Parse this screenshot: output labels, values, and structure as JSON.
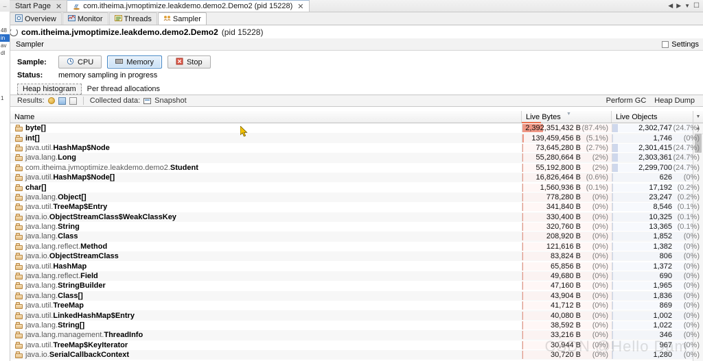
{
  "window": {
    "tabs": [
      {
        "label": "Start Page",
        "icon": "none",
        "active": false,
        "closable": true
      },
      {
        "label": "com.itheima.jvmoptimize.leakdemo.demo2.Demo2 (pid 15228)",
        "icon": "java-app-icon",
        "active": true,
        "closable": true
      }
    ],
    "controls": [
      "prev-arrow",
      "next-arrow",
      "dropdown-arrow",
      "maximize"
    ]
  },
  "tool_tabs": [
    {
      "label": "Overview",
      "icon": "overview-icon",
      "active": false
    },
    {
      "label": "Monitor",
      "icon": "monitor-icon",
      "active": false
    },
    {
      "label": "Threads",
      "icon": "threads-icon",
      "active": false
    },
    {
      "label": "Sampler",
      "icon": "sampler-icon",
      "active": true
    }
  ],
  "process": {
    "name": "com.itheima.jvmoptimize.leakdemo.demo2.Demo2",
    "pid": "(pid 15228)",
    "status_icon": "spinner-icon"
  },
  "panel": {
    "title": "Sampler",
    "settings_label": "Settings",
    "settings_checked": false,
    "sample_label": "Sample:",
    "buttons": [
      {
        "label": "CPU",
        "icon": "cpu-icon",
        "selected": false
      },
      {
        "label": "Memory",
        "icon": "memory-icon",
        "selected": true
      },
      {
        "label": "Stop",
        "icon": "stop-icon",
        "selected": false
      }
    ],
    "status_label": "Status:",
    "status_value": "memory sampling in progress"
  },
  "subtabs": [
    {
      "label": "Heap histogram",
      "active": true
    },
    {
      "label": "Per thread allocations",
      "active": false
    }
  ],
  "results_bar": {
    "results_label": "Results:",
    "icons": [
      "ball-icon",
      "refresh-icon",
      "delta-icon"
    ],
    "collected_label": "Collected data:",
    "snapshot_label": "Snapshot",
    "snapshot_icon": "snapshot-icon",
    "perform_gc_label": "Perform GC",
    "heap_dump_label": "Heap Dump"
  },
  "table": {
    "columns": [
      {
        "key": "name",
        "label": "Name"
      },
      {
        "key": "bytes",
        "label": "Live Bytes",
        "sorted": "desc"
      },
      {
        "key": "objects",
        "label": "Live Objects"
      }
    ],
    "bar_color_bytes": "#ef9785",
    "bar_color_objects": "#cfd8ec",
    "rows": [
      {
        "pkg": "",
        "cls": "byte[]",
        "bytes": "2,392,351,432 B",
        "bytes_pct": "(87.4%)",
        "bytes_w": 100,
        "objs": "2,302,747",
        "objs_pct": "(24.7%)",
        "objs_w": 28
      },
      {
        "pkg": "",
        "cls": "int[]",
        "bytes": "139,459,456 B",
        "bytes_pct": "(5.1%)",
        "bytes_w": 6,
        "objs": "1,746",
        "objs_pct": "(0%)",
        "objs_w": 1
      },
      {
        "pkg": "java.util.",
        "cls": "HashMap$Node",
        "bytes": "73,645,280 B",
        "bytes_pct": "(2.7%)",
        "bytes_w": 4,
        "objs": "2,301,415",
        "objs_pct": "(24.7%)",
        "objs_w": 28
      },
      {
        "pkg": "java.lang.",
        "cls": "Long",
        "bytes": "55,280,664 B",
        "bytes_pct": "(2%)",
        "bytes_w": 3,
        "objs": "2,303,361",
        "objs_pct": "(24.7%)",
        "objs_w": 28
      },
      {
        "pkg": "com.itheima.jvmoptimize.leakdemo.demo2.",
        "cls": "Student",
        "bytes": "55,192,800 B",
        "bytes_pct": "(2%)",
        "bytes_w": 3,
        "objs": "2,299,700",
        "objs_pct": "(24.7%)",
        "objs_w": 28
      },
      {
        "pkg": "java.util.",
        "cls": "HashMap$Node[]",
        "bytes": "16,826,464 B",
        "bytes_pct": "(0.6%)",
        "bytes_w": 2,
        "objs": "626",
        "objs_pct": "(0%)",
        "objs_w": 1
      },
      {
        "pkg": "",
        "cls": "char[]",
        "bytes": "1,560,936 B",
        "bytes_pct": "(0.1%)",
        "bytes_w": 2,
        "objs": "17,192",
        "objs_pct": "(0.2%)",
        "objs_w": 1
      },
      {
        "pkg": "java.lang.",
        "cls": "Object[]",
        "bytes": "778,280 B",
        "bytes_pct": "(0%)",
        "bytes_w": 2,
        "objs": "23,247",
        "objs_pct": "(0.2%)",
        "objs_w": 1
      },
      {
        "pkg": "java.util.",
        "cls": "TreeMap$Entry",
        "bytes": "341,840 B",
        "bytes_pct": "(0%)",
        "bytes_w": 2,
        "objs": "8,546",
        "objs_pct": "(0.1%)",
        "objs_w": 1
      },
      {
        "pkg": "java.io.",
        "cls": "ObjectStreamClass$WeakClassKey",
        "bytes": "330,400 B",
        "bytes_pct": "(0%)",
        "bytes_w": 2,
        "objs": "10,325",
        "objs_pct": "(0.1%)",
        "objs_w": 1
      },
      {
        "pkg": "java.lang.",
        "cls": "String",
        "bytes": "320,760 B",
        "bytes_pct": "(0%)",
        "bytes_w": 2,
        "objs": "13,365",
        "objs_pct": "(0.1%)",
        "objs_w": 1
      },
      {
        "pkg": "java.lang.",
        "cls": "Class",
        "bytes": "208,920 B",
        "bytes_pct": "(0%)",
        "bytes_w": 2,
        "objs": "1,852",
        "objs_pct": "(0%)",
        "objs_w": 1
      },
      {
        "pkg": "java.lang.reflect.",
        "cls": "Method",
        "bytes": "121,616 B",
        "bytes_pct": "(0%)",
        "bytes_w": 2,
        "objs": "1,382",
        "objs_pct": "(0%)",
        "objs_w": 1
      },
      {
        "pkg": "java.io.",
        "cls": "ObjectStreamClass",
        "bytes": "83,824 B",
        "bytes_pct": "(0%)",
        "bytes_w": 2,
        "objs": "806",
        "objs_pct": "(0%)",
        "objs_w": 1
      },
      {
        "pkg": "java.util.",
        "cls": "HashMap",
        "bytes": "65,856 B",
        "bytes_pct": "(0%)",
        "bytes_w": 2,
        "objs": "1,372",
        "objs_pct": "(0%)",
        "objs_w": 1
      },
      {
        "pkg": "java.lang.reflect.",
        "cls": "Field",
        "bytes": "49,680 B",
        "bytes_pct": "(0%)",
        "bytes_w": 2,
        "objs": "690",
        "objs_pct": "(0%)",
        "objs_w": 1
      },
      {
        "pkg": "java.lang.",
        "cls": "StringBuilder",
        "bytes": "47,160 B",
        "bytes_pct": "(0%)",
        "bytes_w": 2,
        "objs": "1,965",
        "objs_pct": "(0%)",
        "objs_w": 1
      },
      {
        "pkg": "java.lang.",
        "cls": "Class[]",
        "bytes": "43,904 B",
        "bytes_pct": "(0%)",
        "bytes_w": 2,
        "objs": "1,836",
        "objs_pct": "(0%)",
        "objs_w": 1
      },
      {
        "pkg": "java.util.",
        "cls": "TreeMap",
        "bytes": "41,712 B",
        "bytes_pct": "(0%)",
        "bytes_w": 2,
        "objs": "869",
        "objs_pct": "(0%)",
        "objs_w": 1
      },
      {
        "pkg": "java.util.",
        "cls": "LinkedHashMap$Entry",
        "bytes": "40,080 B",
        "bytes_pct": "(0%)",
        "bytes_w": 2,
        "objs": "1,002",
        "objs_pct": "(0%)",
        "objs_w": 1
      },
      {
        "pkg": "java.lang.",
        "cls": "String[]",
        "bytes": "38,592 B",
        "bytes_pct": "(0%)",
        "bytes_w": 2,
        "objs": "1,022",
        "objs_pct": "(0%)",
        "objs_w": 1
      },
      {
        "pkg": "java.lang.management.",
        "cls": "ThreadInfo",
        "bytes": "33,216 B",
        "bytes_pct": "(0%)",
        "bytes_w": 2,
        "objs": "346",
        "objs_pct": "(0%)",
        "objs_w": 1
      },
      {
        "pkg": "java.util.",
        "cls": "TreeMap$KeyIterator",
        "bytes": "30,944 B",
        "bytes_pct": "(0%)",
        "bytes_w": 2,
        "objs": "967",
        "objs_pct": "(0%)",
        "objs_w": 1
      },
      {
        "pkg": "java.io.",
        "cls": "SerialCallbackContext",
        "bytes": "30,720 B",
        "bytes_pct": "(0%)",
        "bytes_w": 2,
        "objs": "1,280",
        "objs_pct": "(0%)",
        "objs_w": 1
      }
    ]
  },
  "left_strip": {
    "fragments": [
      "48",
      "in",
      "av",
      "dl",
      "",
      "",
      "",
      "",
      "",
      "",
      "1"
    ]
  },
  "watermark": "CSDN @Hello Dam"
}
